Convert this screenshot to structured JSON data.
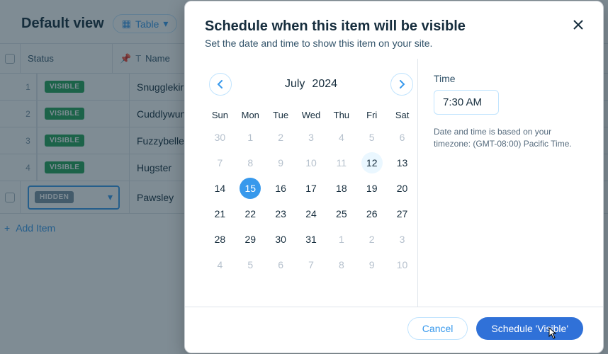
{
  "view": {
    "title": "Default view",
    "chip_label": "Table",
    "col_status": "Status",
    "col_name": "Name",
    "add_item": "Add Item"
  },
  "rows": [
    {
      "idx": "1",
      "status_label": "VISIBLE",
      "status_kind": "green",
      "name": "Snugglekir"
    },
    {
      "idx": "2",
      "status_label": "VISIBLE",
      "status_kind": "green",
      "name": "Cuddlywun"
    },
    {
      "idx": "3",
      "status_label": "VISIBLE",
      "status_kind": "green",
      "name": "Fuzzybelle"
    },
    {
      "idx": "4",
      "status_label": "VISIBLE",
      "status_kind": "green",
      "name": "Hugster"
    },
    {
      "idx": "",
      "status_label": "HIDDEN",
      "status_kind": "gray",
      "name": "Pawsley"
    }
  ],
  "modal": {
    "title": "Schedule when this item will be visible",
    "subtitle": "Set the date and time to show this item on your site.",
    "month": "July",
    "year": "2024",
    "dow": [
      "Sun",
      "Mon",
      "Tue",
      "Wed",
      "Thu",
      "Fri",
      "Sat"
    ],
    "weeks": [
      [
        {
          "d": "30",
          "o": true
        },
        {
          "d": "1",
          "o": true
        },
        {
          "d": "2",
          "o": true
        },
        {
          "d": "3",
          "o": true
        },
        {
          "d": "4",
          "o": true
        },
        {
          "d": "5",
          "o": true
        },
        {
          "d": "6",
          "o": true
        }
      ],
      [
        {
          "d": "7",
          "o": true
        },
        {
          "d": "8",
          "o": true
        },
        {
          "d": "9",
          "o": true
        },
        {
          "d": "10",
          "o": true
        },
        {
          "d": "11",
          "o": true
        },
        {
          "d": "12",
          "today": true
        },
        {
          "d": "13"
        }
      ],
      [
        {
          "d": "14"
        },
        {
          "d": "15",
          "sel": true
        },
        {
          "d": "16"
        },
        {
          "d": "17"
        },
        {
          "d": "18"
        },
        {
          "d": "19"
        },
        {
          "d": "20"
        }
      ],
      [
        {
          "d": "21"
        },
        {
          "d": "22"
        },
        {
          "d": "23"
        },
        {
          "d": "24"
        },
        {
          "d": "25"
        },
        {
          "d": "26"
        },
        {
          "d": "27"
        }
      ],
      [
        {
          "d": "28"
        },
        {
          "d": "29"
        },
        {
          "d": "30"
        },
        {
          "d": "31"
        },
        {
          "d": "1",
          "o": true
        },
        {
          "d": "2",
          "o": true
        },
        {
          "d": "3",
          "o": true
        }
      ],
      [
        {
          "d": "4",
          "o": true
        },
        {
          "d": "5",
          "o": true
        },
        {
          "d": "6",
          "o": true
        },
        {
          "d": "7",
          "o": true
        },
        {
          "d": "8",
          "o": true
        },
        {
          "d": "9",
          "o": true
        },
        {
          "d": "10",
          "o": true
        }
      ]
    ],
    "time_label": "Time",
    "time_value": "7:30 AM",
    "tz_note": "Date and time is based on your timezone: (GMT-08:00) Pacific Time.",
    "cancel": "Cancel",
    "confirm": "Schedule 'Visible'"
  }
}
